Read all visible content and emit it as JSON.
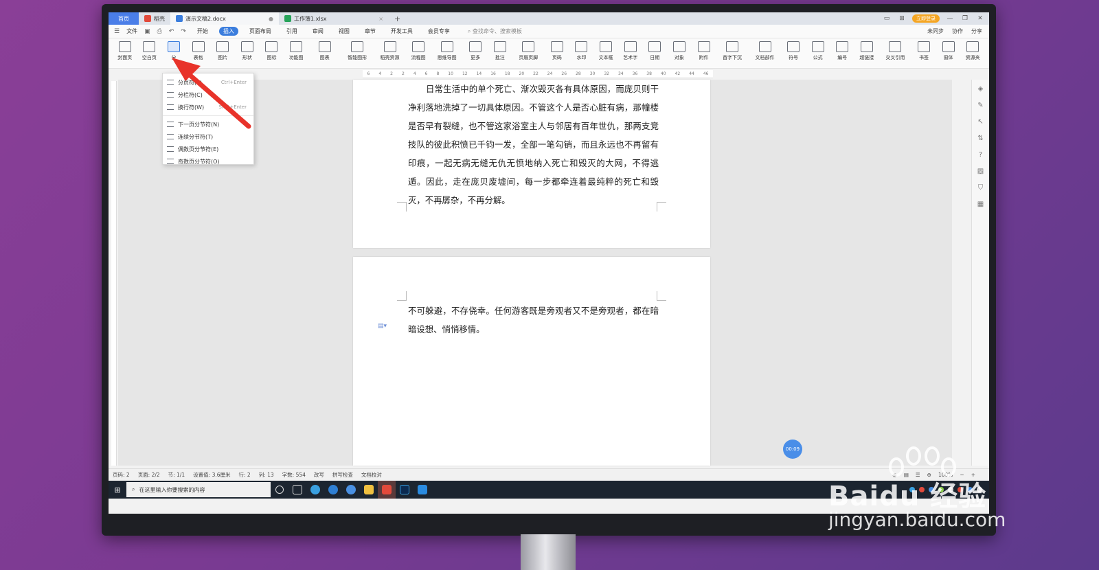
{
  "title_bar": {
    "tabs": [
      {
        "label": "首页"
      },
      {
        "label": "稻壳"
      },
      {
        "label": "演示文稿2.docx"
      },
      {
        "label": "工作簿1.xlsx"
      }
    ],
    "login_label": "立即登录"
  },
  "menu": {
    "file": "文件",
    "items": [
      "开始",
      "插入",
      "页面布局",
      "引用",
      "审阅",
      "视图",
      "章节",
      "开发工具",
      "会员专享"
    ],
    "search": "查找命令、搜索模板",
    "right": [
      "未同步",
      "协作",
      "分享"
    ]
  },
  "ribbon": [
    {
      "label": "封面页"
    },
    {
      "label": "空白页"
    },
    {
      "label": "分"
    },
    {
      "label": "表格"
    },
    {
      "label": "图片"
    },
    {
      "label": "形状"
    },
    {
      "label": "图标"
    },
    {
      "label": "功能图"
    },
    {
      "label": "图表"
    },
    {
      "label": "智能图形"
    },
    {
      "label": "稻壳资源"
    },
    {
      "label": "流程图"
    },
    {
      "label": "思维导图"
    },
    {
      "label": "更多"
    },
    {
      "label": "批注"
    },
    {
      "label": "页眉页脚"
    },
    {
      "label": "页码"
    },
    {
      "label": "水印"
    },
    {
      "label": "文本框"
    },
    {
      "label": "艺术字"
    },
    {
      "label": "日期"
    },
    {
      "label": "对象"
    },
    {
      "label": "附件"
    },
    {
      "label": "首字下沉"
    },
    {
      "label": "文档部件"
    },
    {
      "label": "符号"
    },
    {
      "label": "公式"
    },
    {
      "label": "编号"
    },
    {
      "label": "超链接"
    },
    {
      "label": "交叉引用"
    },
    {
      "label": "书签"
    },
    {
      "label": "窗体"
    },
    {
      "label": "资源夹"
    }
  ],
  "dropdown": {
    "items": [
      {
        "label": "分页符(P)",
        "shortcut": "Ctrl+Enter"
      },
      {
        "label": "分栏符(C)",
        "shortcut": ""
      },
      {
        "label": "换行符(W)",
        "shortcut": "Shift+Enter"
      },
      {
        "label": "下一页分节符(N)",
        "shortcut": ""
      },
      {
        "label": "连续分节符(T)",
        "shortcut": ""
      },
      {
        "label": "偶数页分节符(E)",
        "shortcut": ""
      },
      {
        "label": "奇数页分节符(O)",
        "shortcut": ""
      }
    ]
  },
  "ruler_ticks": [
    "6",
    "4",
    "2",
    "2",
    "4",
    "6",
    "8",
    "10",
    "12",
    "14",
    "16",
    "18",
    "20",
    "22",
    "24",
    "26",
    "28",
    "30",
    "32",
    "34",
    "36",
    "38",
    "40",
    "42",
    "44",
    "46"
  ],
  "document": {
    "page1_text": "日常生活中的单个死亡、渐次毁灭各有具体原因，而庞贝则干净利落地洗掉了一切具体原因。不管这个人是否心脏有病，那幢楼是否早有裂缝，也不管这家浴室主人与邻居有百年世仇，那两支竞技队的彼此积愤已千钧一发，全部一笔勾销，而且永远也不再留有印痕，一起无病无缝无仇无愤地纳入死亡和毁灭的大网，不得逃遁。因此，走在庞贝废墟间，每一步都牵连着最纯粹的死亡和毁灭，不再孱杂，不再分解。",
    "page2_text": "不可躲避，不存侥幸。任何游客既是旁观者又不是旁观者，都在暗暗设想、悄悄移情。"
  },
  "timer": "00:09",
  "status_bar": {
    "items": [
      "页码: 2",
      "页面: 2/2",
      "节: 1/1",
      "设置值: 3.6厘米",
      "行: 2",
      "列: 13",
      "字数: 554",
      "改写",
      "拼写检查",
      "文档校对"
    ],
    "zoom": "100%"
  },
  "taskbar": {
    "search_placeholder": "在这里输入你要搜索的内容"
  },
  "watermark": {
    "brand": "Baidu 经验",
    "url": "jingyan.baidu.com"
  },
  "colors": {
    "accent": "#3b7ddd",
    "arrow": "#e8332a",
    "background": "#7a3a92"
  }
}
